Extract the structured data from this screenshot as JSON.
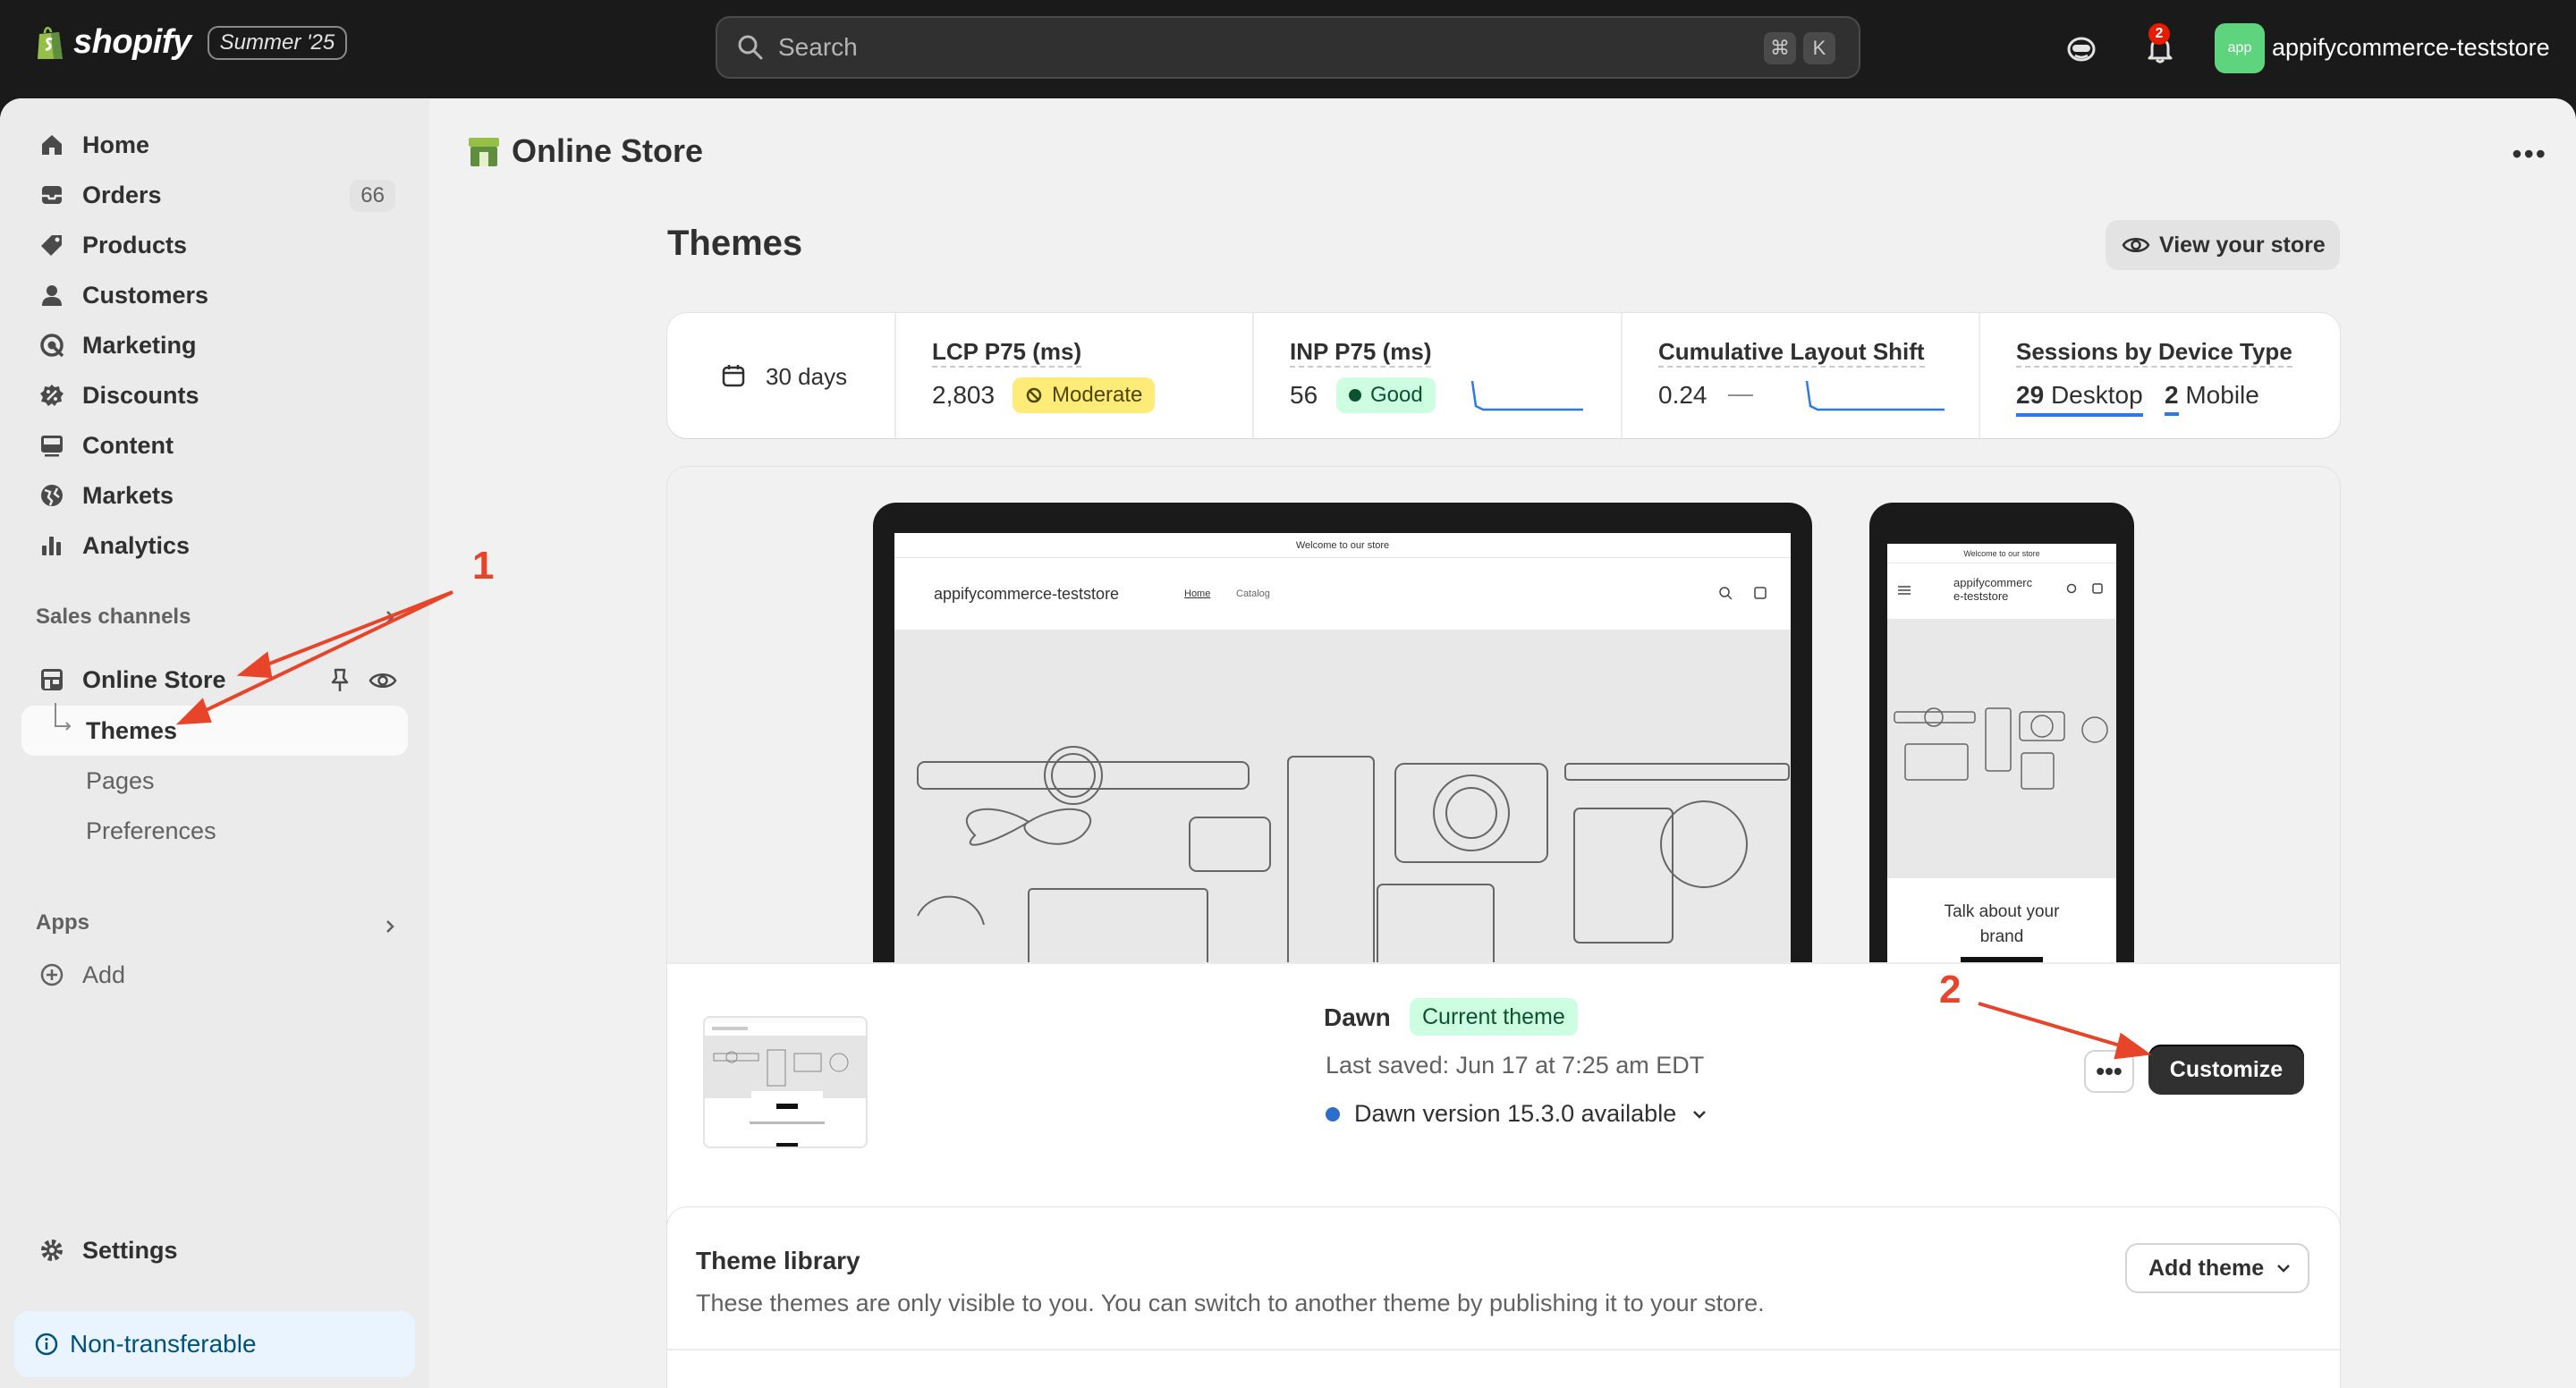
{
  "topbar": {
    "brand": "shopify",
    "edition_badge": "Summer '25",
    "search_placeholder": "Search",
    "shortcut_keys": [
      "⌘",
      "K"
    ],
    "notification_count": "2",
    "avatar_text": "app",
    "store_name": "appifycommerce-teststore"
  },
  "sidebar": {
    "items": [
      {
        "label": "Home",
        "icon": "home-icon"
      },
      {
        "label": "Orders",
        "icon": "inbox-icon",
        "count": "66"
      },
      {
        "label": "Products",
        "icon": "tag-icon"
      },
      {
        "label": "Customers",
        "icon": "person-icon"
      },
      {
        "label": "Marketing",
        "icon": "target-icon"
      },
      {
        "label": "Discounts",
        "icon": "discount-icon"
      },
      {
        "label": "Content",
        "icon": "image-icon"
      },
      {
        "label": "Markets",
        "icon": "globe-icon"
      },
      {
        "label": "Analytics",
        "icon": "bar-chart-icon"
      }
    ],
    "sales_channels_label": "Sales channels",
    "online_store_label": "Online Store",
    "online_store_subitems": [
      "Themes",
      "Pages",
      "Preferences"
    ],
    "apps_label": "Apps",
    "add_label": "Add",
    "settings_label": "Settings",
    "non_transferable_label": "Non-transferable"
  },
  "header": {
    "title": "Online Store"
  },
  "themes_page": {
    "heading": "Themes",
    "view_store_label": "View your store",
    "period": "30 days",
    "metrics": {
      "lcp_label": "LCP P75 (ms)",
      "lcp_value": "2,803",
      "lcp_status": "Moderate",
      "inp_label": "INP P75 (ms)",
      "inp_value": "56",
      "inp_status": "Good",
      "cls_label": "Cumulative Layout Shift",
      "cls_value": "0.24",
      "cls_status": "—",
      "sessions_label": "Sessions by Device Type",
      "desktop_count": "29",
      "desktop_label": "Desktop",
      "mobile_count": "2",
      "mobile_label": "Mobile"
    },
    "preview": {
      "announcement": "Welcome to our store",
      "store_name": "appifycommerce-teststore",
      "nav_home": "Home",
      "nav_catalog": "Catalog",
      "mobile_store_name_line1": "appifycommerc",
      "mobile_store_name_line2": "e-teststore",
      "mobile_tagline_line1": "Talk about your",
      "mobile_tagline_line2": "brand"
    },
    "current_theme": {
      "name": "Dawn",
      "badge": "Current theme",
      "last_saved": "Last saved: Jun 17 at 7:25 am EDT",
      "update_notice": "Dawn version 15.3.0 available",
      "customize_label": "Customize"
    },
    "library": {
      "title": "Theme library",
      "description": "These themes are only visible to you. You can switch to another theme by publishing it to your store.",
      "add_theme_label": "Add theme"
    }
  },
  "annotations": {
    "step1": "1",
    "step2": "2"
  },
  "colors": {
    "topbar_bg": "#1a1a1a",
    "moderate_badge": "#ffeb78",
    "good_badge": "#cdfee1",
    "sparkline": "#2c7be5",
    "annotation": "#e8442a",
    "avatar_bg": "#5fd47f"
  }
}
